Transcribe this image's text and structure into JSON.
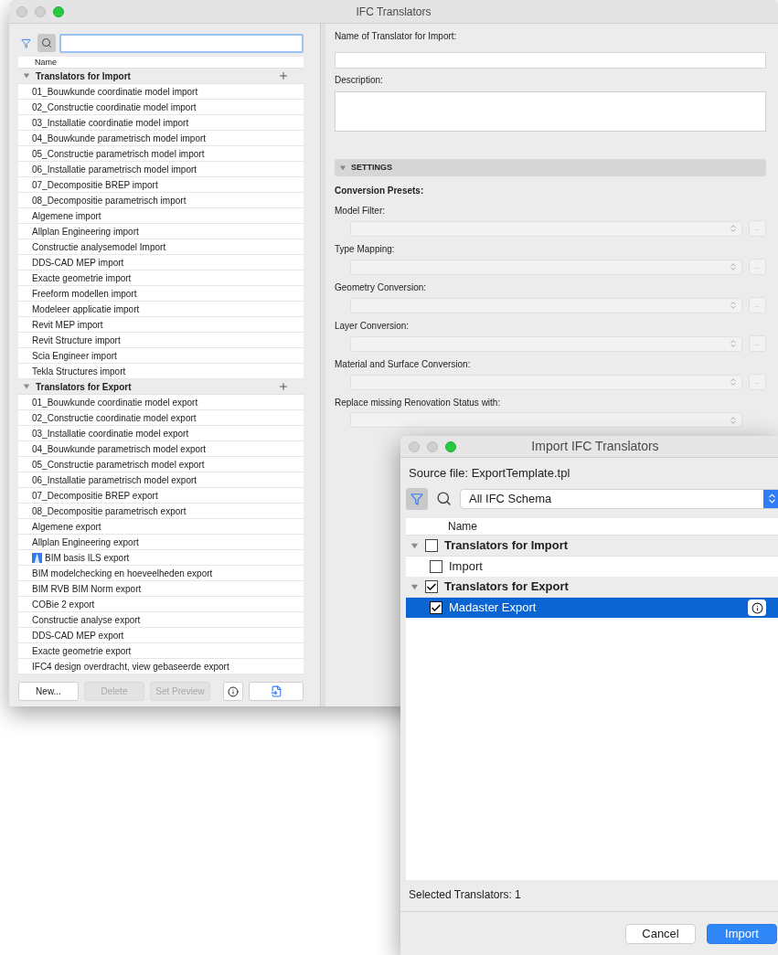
{
  "window": {
    "title": "IFC Translators"
  },
  "list": {
    "column": "Name",
    "groups": [
      {
        "label": "Translators for Import",
        "expanded": true,
        "items": [
          {
            "label": "01_Bouwkunde coordinatie model import",
            "kind": "plain"
          },
          {
            "label": "02_Constructie coordinatie model import",
            "kind": "plain"
          },
          {
            "label": "03_Installatie coordinatie model import",
            "kind": "plain"
          },
          {
            "label": "04_Bouwkunde parametrisch model import",
            "kind": "plain"
          },
          {
            "label": "05_Constructie parametrisch model import",
            "kind": "plain"
          },
          {
            "label": "06_Installatie parametrisch model import",
            "kind": "plain"
          },
          {
            "label": "07_Decompositie BREP import",
            "kind": "plain"
          },
          {
            "label": "08_Decompositie parametrisch import",
            "kind": "plain"
          },
          {
            "label": "Algemene import",
            "kind": "plain"
          },
          {
            "label": "Allplan Engineering import",
            "kind": "plain"
          },
          {
            "label": "Constructie analysemodel Import",
            "kind": "plain"
          },
          {
            "label": "DDS-CAD MEP import",
            "kind": "plain"
          },
          {
            "label": "Exacte geometrie import",
            "kind": "plain"
          },
          {
            "label": "Freeform modellen import",
            "kind": "plain"
          },
          {
            "label": "Modeleer applicatie import",
            "kind": "plain"
          },
          {
            "label": "Revit MEP import",
            "kind": "plain"
          },
          {
            "label": "Revit Structure import",
            "kind": "plain"
          },
          {
            "label": "Scia Engineer import",
            "kind": "plain"
          },
          {
            "label": "Tekla Structures import",
            "kind": "plain"
          }
        ]
      },
      {
        "label": "Translators for Export",
        "expanded": true,
        "items": [
          {
            "label": "01_Bouwkunde coordinatie model export",
            "kind": "plain"
          },
          {
            "label": "02_Constructie coordinatie model export",
            "kind": "plain"
          },
          {
            "label": "03_Installatie coordinatie model export",
            "kind": "plain"
          },
          {
            "label": "04_Bouwkunde parametrisch model export",
            "kind": "plain"
          },
          {
            "label": "05_Constructie parametrisch model export",
            "kind": "plain"
          },
          {
            "label": "06_Installatie parametrisch model export",
            "kind": "plain"
          },
          {
            "label": "07_Decompositie BREP export",
            "kind": "plain"
          },
          {
            "label": "08_Decompositie parametrisch export",
            "kind": "plain"
          },
          {
            "label": "Algemene export",
            "kind": "plain"
          },
          {
            "label": "Allplan Engineering export",
            "kind": "plain"
          },
          {
            "label": "BIM basis ILS export",
            "kind": "icon"
          },
          {
            "label": "BIM modelchecking en hoeveelheden export",
            "kind": "plain"
          },
          {
            "label": "BIM RVB BIM Norm export",
            "kind": "plain"
          },
          {
            "label": "COBie 2 export",
            "kind": "plain"
          },
          {
            "label": "Constructie analyse export",
            "kind": "plain"
          },
          {
            "label": "DDS-CAD MEP export",
            "kind": "plain"
          },
          {
            "label": "Exacte geometrie export",
            "kind": "plain"
          },
          {
            "label": "IFC4 design overdracht, view gebaseerde export",
            "kind": "plain"
          }
        ]
      }
    ]
  },
  "buttons": [
    {
      "label": "New...",
      "disabled": false
    },
    {
      "label": "Delete",
      "disabled": true
    },
    {
      "label": "Set Preview",
      "disabled": true
    }
  ],
  "form": {
    "name_label": "Name of Translator for Import:",
    "description_label": "Description:",
    "settings": {
      "label": "SETTINGS",
      "expanded": true
    },
    "presets_label": "Conversion Presets:",
    "fields": [
      {
        "label": "Model Filter:",
        "more": "..."
      },
      {
        "label": "Type Mapping:",
        "more": "..."
      },
      {
        "label": "Geometry Conversion:",
        "more": "..."
      },
      {
        "label": "Layer Conversion:",
        "more": "..."
      },
      {
        "label": "Material and Surface Conversion:",
        "more": "..."
      },
      {
        "label": "Replace missing Renovation Status with:"
      }
    ]
  },
  "dialog": {
    "title": "Import IFC Translators",
    "source_file": "Source file: ExportTemplate.tpl",
    "filter": "All IFC Schema",
    "column": "Name",
    "groups": [
      {
        "label": "Translators for Import",
        "expanded": true,
        "checked": false,
        "items": [
          {
            "label": "Import",
            "checked": false,
            "selected": false
          }
        ]
      },
      {
        "label": "Translators for Export",
        "expanded": true,
        "checked": true,
        "items": [
          {
            "label": "Madaster Export",
            "checked": true,
            "selected": true
          }
        ]
      }
    ],
    "footer": "Selected Translators: 1",
    "buttons": [
      {
        "label": "Cancel",
        "kind": "cancel"
      },
      {
        "label": "Import",
        "kind": "default"
      }
    ]
  }
}
